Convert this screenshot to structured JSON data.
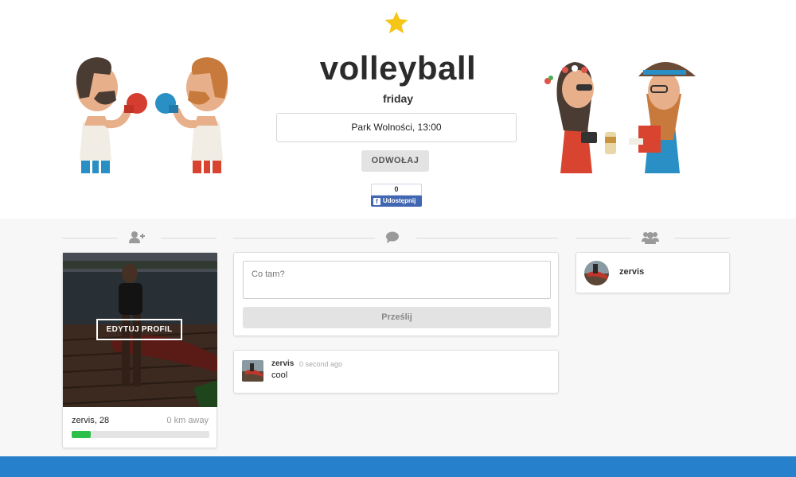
{
  "event": {
    "title": "volleyball",
    "subtitle": "friday",
    "location_time": "Park Wolności, 13:00",
    "cancel_label": "ODWOŁAJ",
    "favorite_icon": "star-icon"
  },
  "share": {
    "count": "0",
    "label": "Udostępnij"
  },
  "sections": {
    "left_icon": "add-user-icon",
    "middle_icon": "comment-icon",
    "right_icon": "users-icon"
  },
  "profile": {
    "edit_label": "EDYTUJ PROFIL",
    "name_age": "zervis, 28",
    "distance": "0 km away",
    "progress": 0.14
  },
  "composer": {
    "placeholder": "Co tam?",
    "submit_label": "Prześlij"
  },
  "comments": [
    {
      "user": "zervis",
      "time": "0 second ago",
      "text": "cool"
    }
  ],
  "members": [
    {
      "name": "zervis"
    }
  ],
  "colors": {
    "accent": "#2780cc",
    "progress": "#2cbf4a",
    "star": "#f5c518",
    "facebook": "#4267b2"
  }
}
